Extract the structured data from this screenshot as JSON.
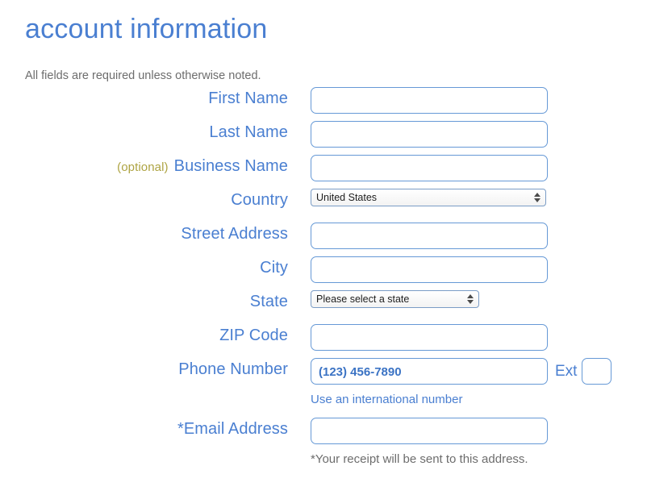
{
  "header": {
    "title": "account information",
    "subtitle": "All fields are required unless otherwise noted."
  },
  "form": {
    "rows": [
      {
        "id": "first-name",
        "label": "First Name",
        "optional_tag": "",
        "control": "text",
        "value": "",
        "placeholder": ""
      },
      {
        "id": "last-name",
        "label": "Last Name",
        "optional_tag": "",
        "control": "text",
        "value": "",
        "placeholder": ""
      },
      {
        "id": "business-name",
        "label": "Business Name",
        "optional_tag": "(optional)",
        "control": "text",
        "value": "",
        "placeholder": ""
      },
      {
        "id": "country",
        "label": "Country",
        "optional_tag": "",
        "control": "select",
        "value": "United States",
        "placeholder": ""
      },
      {
        "id": "street-address",
        "label": "Street Address",
        "optional_tag": "",
        "control": "text",
        "value": "",
        "placeholder": ""
      },
      {
        "id": "city",
        "label": "City",
        "optional_tag": "",
        "control": "text",
        "value": "",
        "placeholder": ""
      },
      {
        "id": "state",
        "label": "State",
        "optional_tag": "",
        "control": "select",
        "value": "Please select a state",
        "placeholder": ""
      },
      {
        "id": "zip-code",
        "label": "ZIP Code",
        "optional_tag": "",
        "control": "text",
        "value": "",
        "placeholder": ""
      },
      {
        "id": "phone-number",
        "label": "Phone Number",
        "optional_tag": "",
        "control": "phone",
        "value": "",
        "placeholder": "(123) 456-7890"
      },
      {
        "id": "email-address",
        "label": "Email Address",
        "label_prefix": "*",
        "optional_tag": "",
        "control": "text",
        "value": "",
        "placeholder": ""
      }
    ],
    "phone_ext_label": "Ext",
    "phone_ext_value": "",
    "phone_ext_placeholder": "",
    "international_link": "Use an international number",
    "email_note": "*Your receipt will be sent to this address."
  },
  "colors": {
    "title_blue": "#4a7fd1",
    "label_blue": "#4a7fd1",
    "border_blue": "#6699d6",
    "optional_olive": "#aea443",
    "gray_text": "#6d6d6d"
  }
}
